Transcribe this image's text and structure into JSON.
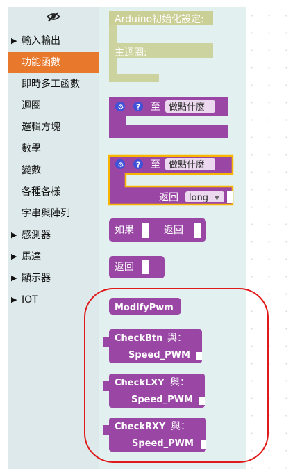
{
  "toolbox": {
    "hide_icon": "eye-slash-icon",
    "items": [
      {
        "label": "輸入輸出",
        "expandable": true,
        "selected": false
      },
      {
        "label": "功能函數",
        "expandable": false,
        "selected": true
      },
      {
        "label": "即時多工函數",
        "expandable": false,
        "selected": false
      },
      {
        "label": "迴圈",
        "expandable": false,
        "selected": false
      },
      {
        "label": "邏輯方塊",
        "expandable": false,
        "selected": false
      },
      {
        "label": "數學",
        "expandable": false,
        "selected": false
      },
      {
        "label": "變數",
        "expandable": false,
        "selected": false
      },
      {
        "label": "各種各樣",
        "expandable": false,
        "selected": false
      },
      {
        "label": "字串與陣列",
        "expandable": false,
        "selected": false
      },
      {
        "label": "感測器",
        "expandable": true,
        "selected": false
      },
      {
        "label": "馬達",
        "expandable": true,
        "selected": false
      },
      {
        "label": "顯示器",
        "expandable": true,
        "selected": false
      },
      {
        "label": "IOT",
        "expandable": true,
        "selected": false
      }
    ]
  },
  "flyout": {
    "setup_block": {
      "setup_label": "Arduino初始化設定:",
      "loop_label": "主迴圈:"
    },
    "proc_noreturn": {
      "to_label": "至",
      "name": "做點什麼"
    },
    "proc_return": {
      "to_label": "至",
      "name": "做點什麼",
      "return_label": "返回",
      "type_value": "long"
    },
    "if_return": {
      "if_label": "如果",
      "return_label": "返回"
    },
    "return_block": {
      "label": "返回"
    },
    "modify_pwm": {
      "label": "ModifyPwm"
    },
    "check_btn": {
      "name": "CheckBtn",
      "with_label": "與：",
      "param": "Speed_PWM"
    },
    "check_lxy": {
      "name": "CheckLXY",
      "with_label": "與：",
      "param": "Speed_PWM"
    },
    "check_rxy": {
      "name": "CheckRXY",
      "with_label": "與：",
      "param": "Speed_PWM"
    }
  },
  "colors": {
    "procedure": "#9a46a5",
    "setup_disabled": "#c9cf95",
    "selected_category": "#e8792c",
    "toolbox_bg": "#dde9ea",
    "flyout_bg": "#e3f0f0",
    "highlight_outline": "#e01a1a",
    "selected_block_border": "#f7b500",
    "return_block": "#5b80a5"
  }
}
